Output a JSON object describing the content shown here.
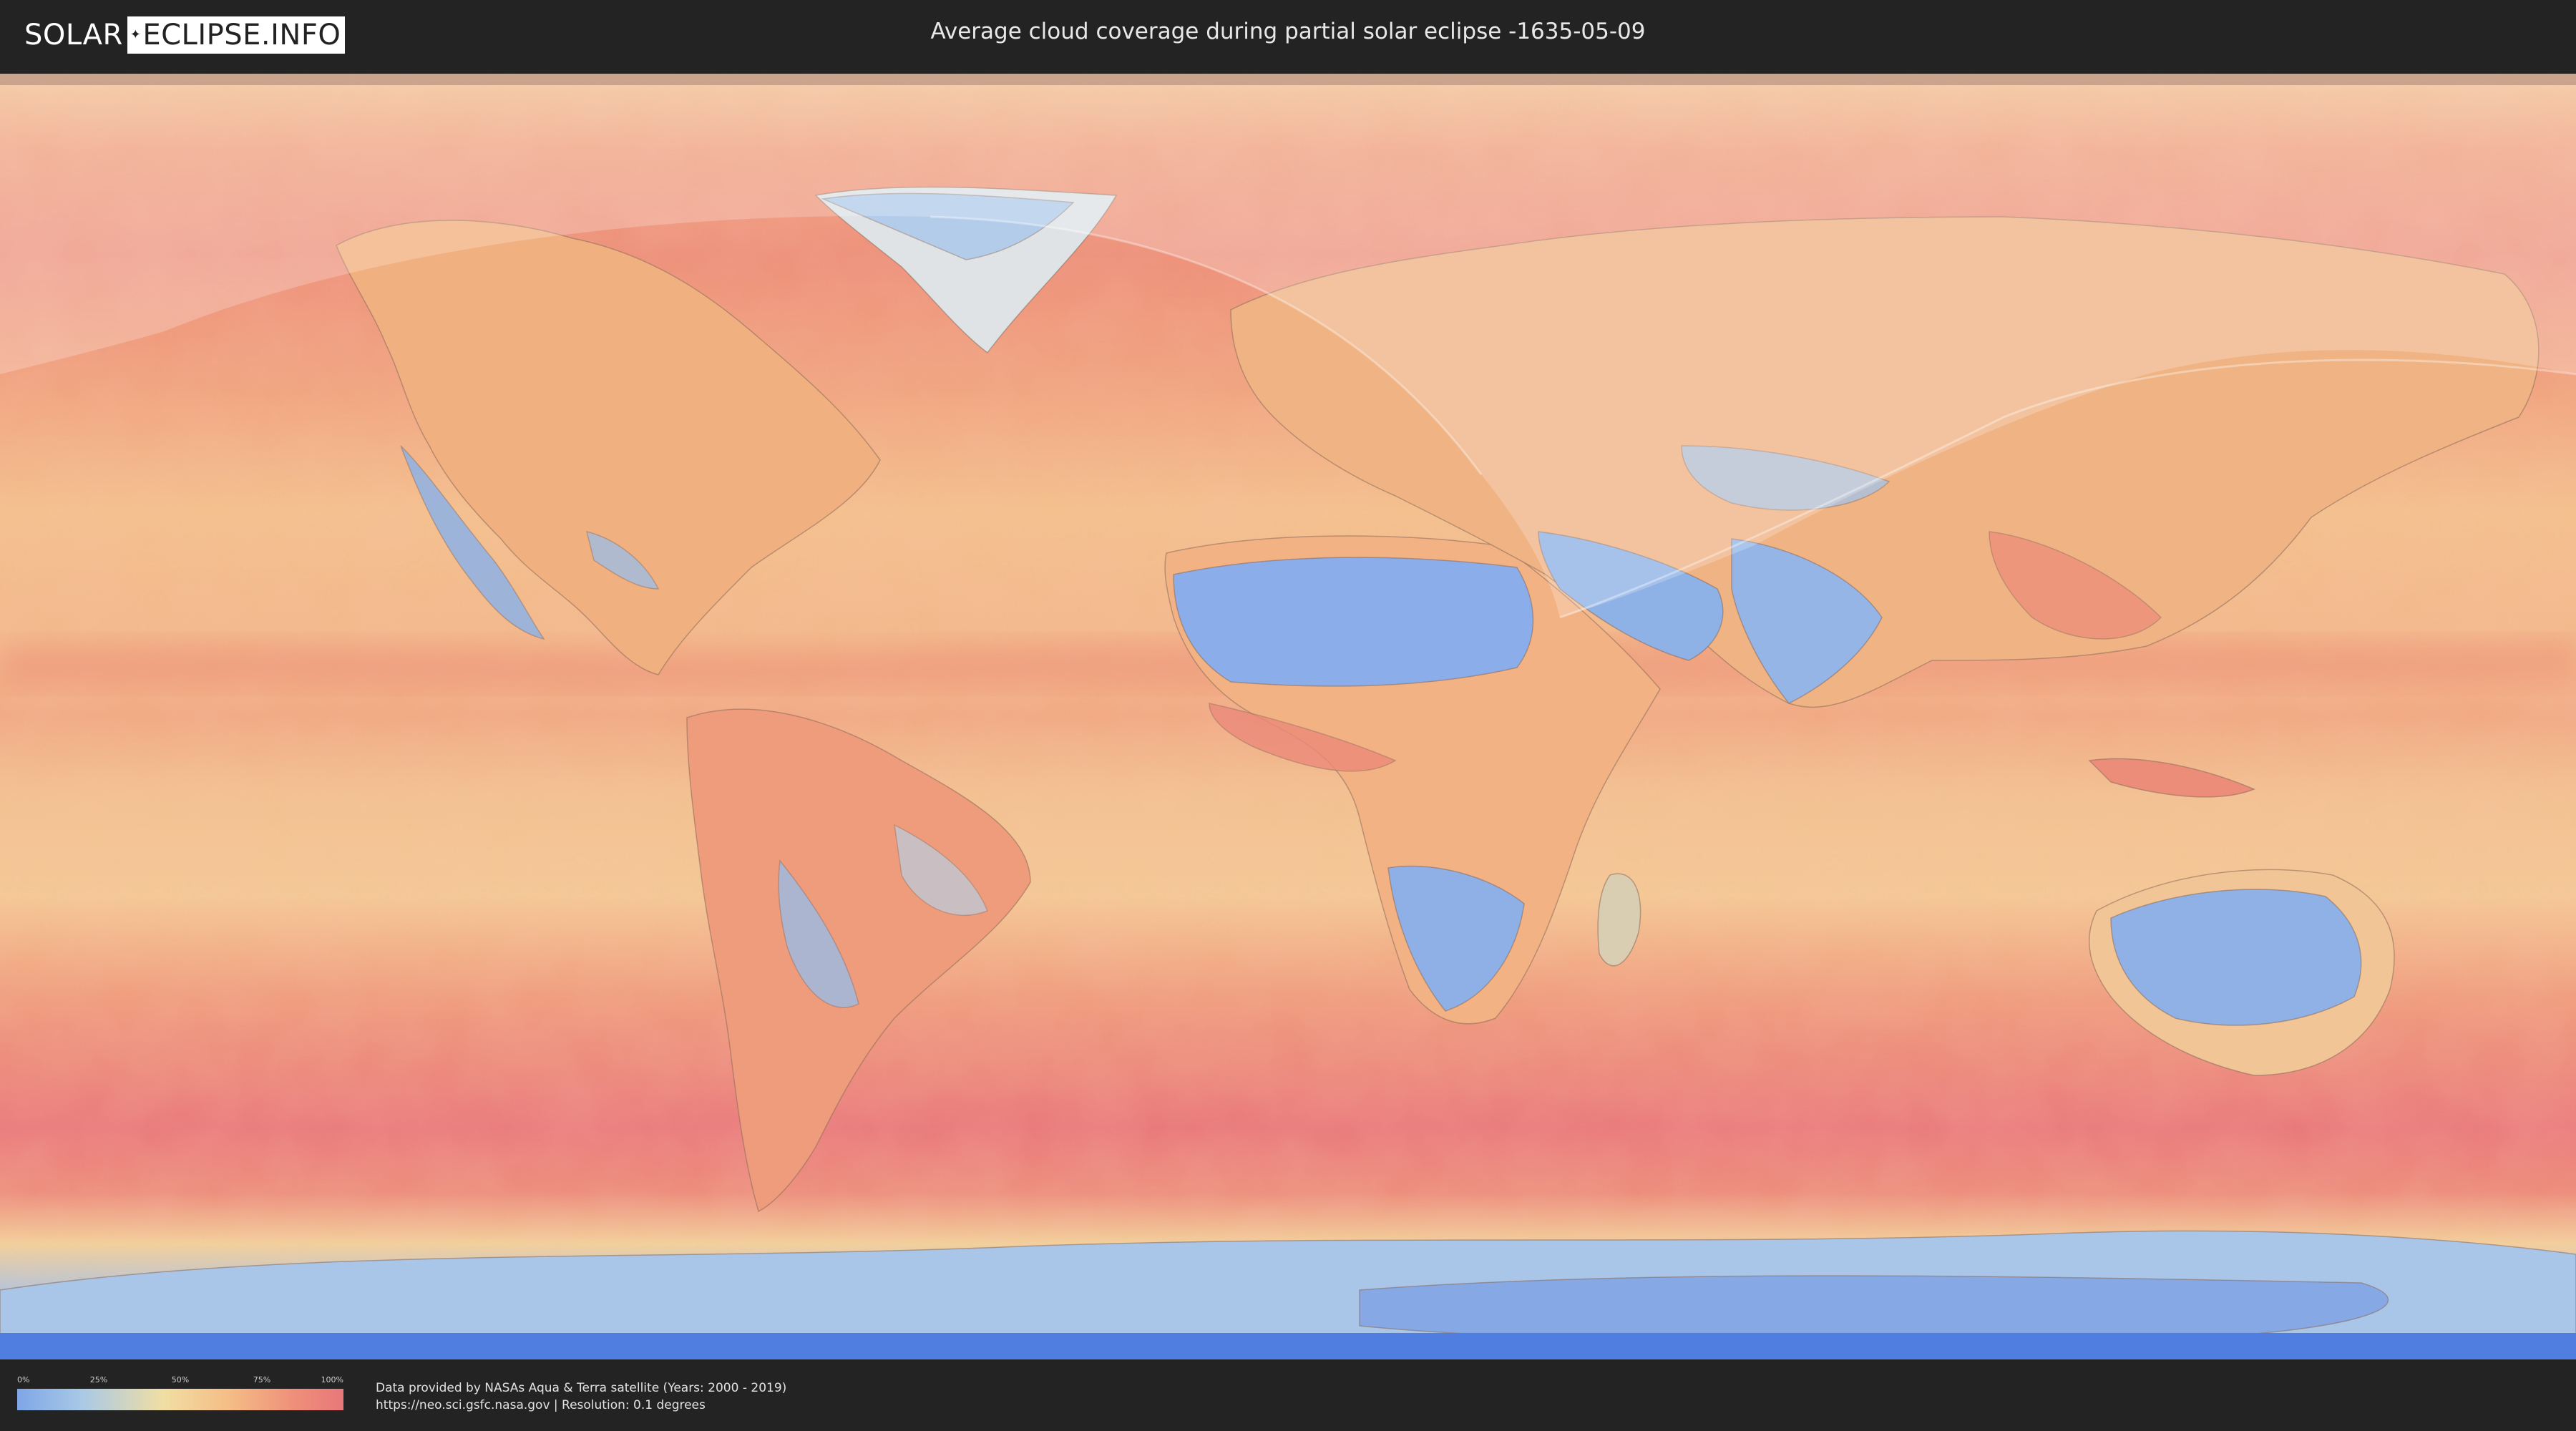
{
  "header": {
    "logo_left": "SOLAR",
    "logo_right": "ECLIPSE.INFO",
    "title": "Average cloud coverage during partial solar eclipse -1635-05-09"
  },
  "map": {
    "variable": "cloud coverage",
    "eclipse_type": "partial",
    "eclipse_date": "-1635-05-09",
    "eclipse_visibility_overlay": "translucent white shaded region covering northern hemisphere areas where the partial eclipse is visible"
  },
  "legend": {
    "ticks": [
      "0%",
      "25%",
      "50%",
      "75%",
      "100%"
    ],
    "tick_values": [
      0,
      25,
      50,
      75,
      100
    ],
    "colors": {
      "low": "#7ea6e6",
      "mid_low": "#a9c9e6",
      "mid": "#f1dea3",
      "mid_high": "#f4bd86",
      "high": "#e8777a"
    }
  },
  "footer": {
    "attribution_line1": "Data provided by NASAs Aqua & Terra satellite (Years: 2000 - 2019)",
    "attribution_line2": "https://neo.sci.gsfc.nasa.gov | Resolution: 0.1 degrees"
  }
}
